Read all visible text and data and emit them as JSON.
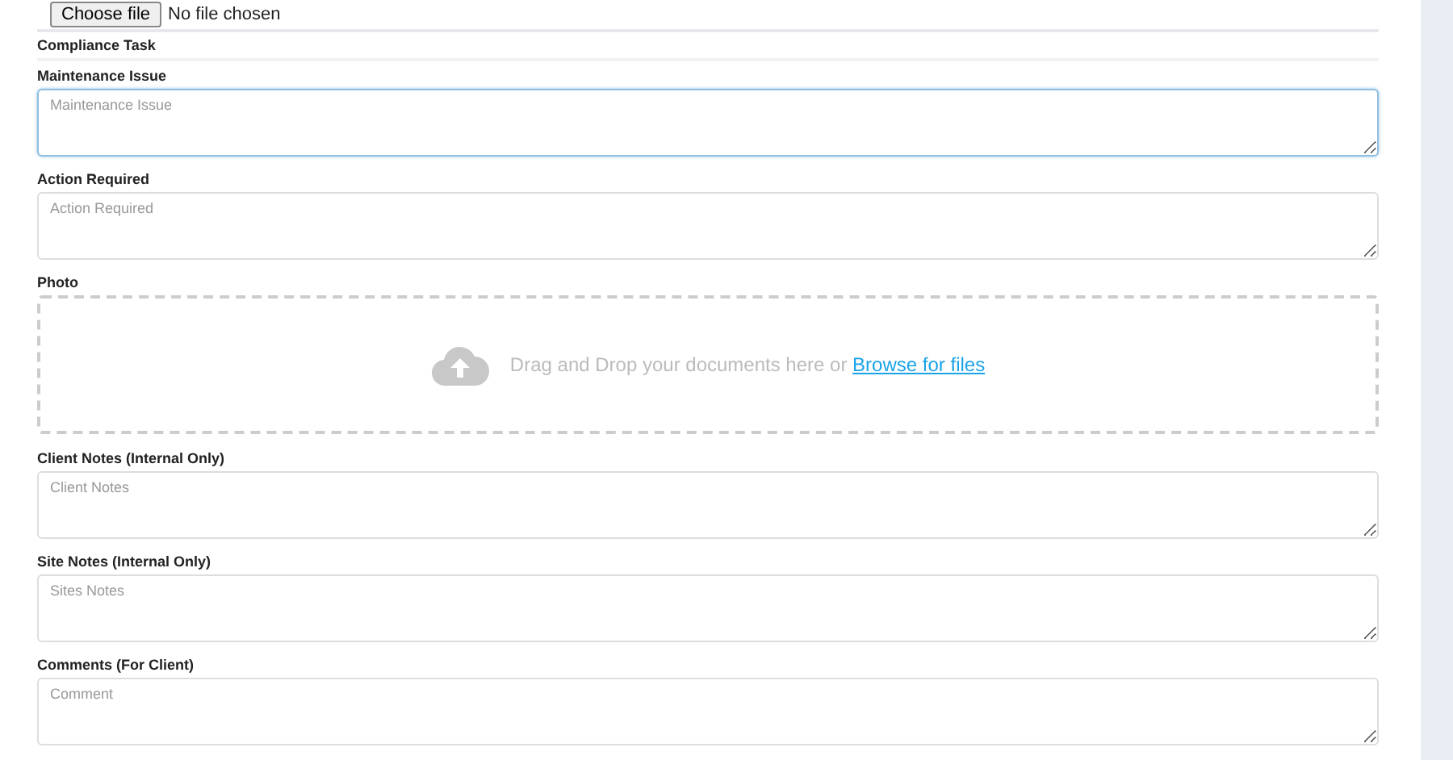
{
  "file_input": {
    "button": "Choose file",
    "status": "No file chosen"
  },
  "section_title": "Compliance Task",
  "fields": [
    {
      "kind": "textarea",
      "label": "Maintenance Issue",
      "placeholder": "Maintenance Issue",
      "focused": true
    },
    {
      "kind": "textarea",
      "label": "Action Required",
      "placeholder": "Action Required",
      "focused": false
    },
    {
      "kind": "dropzone",
      "label": "Photo",
      "text": "Drag and Drop your documents here or",
      "link": "Browse for files"
    },
    {
      "kind": "textarea",
      "label": "Client Notes (Internal Only)",
      "placeholder": "Client Notes",
      "focused": false
    },
    {
      "kind": "textarea",
      "label": "Site Notes (Internal Only)",
      "placeholder": "Sites Notes",
      "focused": false
    },
    {
      "kind": "textarea",
      "label": "Comments (For Client)",
      "placeholder": "Comment",
      "focused": false
    }
  ]
}
